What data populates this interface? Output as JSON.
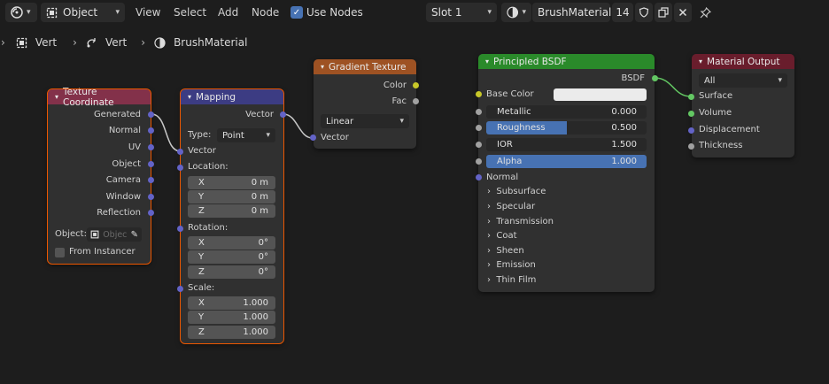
{
  "header": {
    "editor_type_icon": "node-editor-icon",
    "object_label": "Object",
    "menus": [
      "View",
      "Select",
      "Add",
      "Node"
    ],
    "use_nodes_label": "Use Nodes",
    "use_nodes_checked": true,
    "slot_label": "Slot 1",
    "material_name": "BrushMaterial",
    "user_count": "14"
  },
  "breadcrumb": {
    "items": [
      "Vert",
      "Vert",
      "BrushMaterial"
    ]
  },
  "nodes": {
    "texcoord": {
      "title": "Texture Coordinate",
      "outputs": [
        "Generated",
        "Normal",
        "UV",
        "Object",
        "Camera",
        "Window",
        "Reflection"
      ],
      "object_label": "Object:",
      "object_placeholder": "Objec",
      "from_instancer": "From Instancer"
    },
    "mapping": {
      "title": "Mapping",
      "output": "Vector",
      "type_label": "Type:",
      "type_value": "Point",
      "vector_input": "Vector",
      "location_label": "Location:",
      "location": [
        {
          "axis": "X",
          "value": "0 m"
        },
        {
          "axis": "Y",
          "value": "0 m"
        },
        {
          "axis": "Z",
          "value": "0 m"
        }
      ],
      "rotation_label": "Rotation:",
      "rotation": [
        {
          "axis": "X",
          "value": "0°"
        },
        {
          "axis": "Y",
          "value": "0°"
        },
        {
          "axis": "Z",
          "value": "0°"
        }
      ],
      "scale_label": "Scale:",
      "scale": [
        {
          "axis": "X",
          "value": "1.000"
        },
        {
          "axis": "Y",
          "value": "1.000"
        },
        {
          "axis": "Z",
          "value": "1.000"
        }
      ]
    },
    "gradient": {
      "title": "Gradient Texture",
      "outputs": [
        "Color",
        "Fac"
      ],
      "type_value": "Linear",
      "vector_input": "Vector"
    },
    "bsdf": {
      "title": "Principled BSDF",
      "output": "BSDF",
      "base_color_label": "Base Color",
      "base_color": "#ebebeb",
      "fields": [
        {
          "label": "Metallic",
          "value": "0.000",
          "fill": 0.0
        },
        {
          "label": "Roughness",
          "value": "0.500",
          "fill": 0.5
        },
        {
          "label": "IOR",
          "value": "1.500",
          "fill": 0.0
        },
        {
          "label": "Alpha",
          "value": "1.000",
          "fill": 1.0
        }
      ],
      "normal_label": "Normal",
      "panels": [
        "Subsurface",
        "Specular",
        "Transmission",
        "Coat",
        "Sheen",
        "Emission",
        "Thin Film"
      ]
    },
    "output": {
      "title": "Material Output",
      "target": "All",
      "inputs": [
        "Surface",
        "Volume",
        "Displacement",
        "Thickness"
      ]
    }
  },
  "colors": {
    "texcoord_header": "#83314a",
    "mapping_header": "#3c3c83",
    "gradient_header": "#9e5223",
    "bsdf_header": "#2a8a2a",
    "output_header": "#691d2c",
    "selection": "#ed5700",
    "accent": "#4772b3"
  }
}
